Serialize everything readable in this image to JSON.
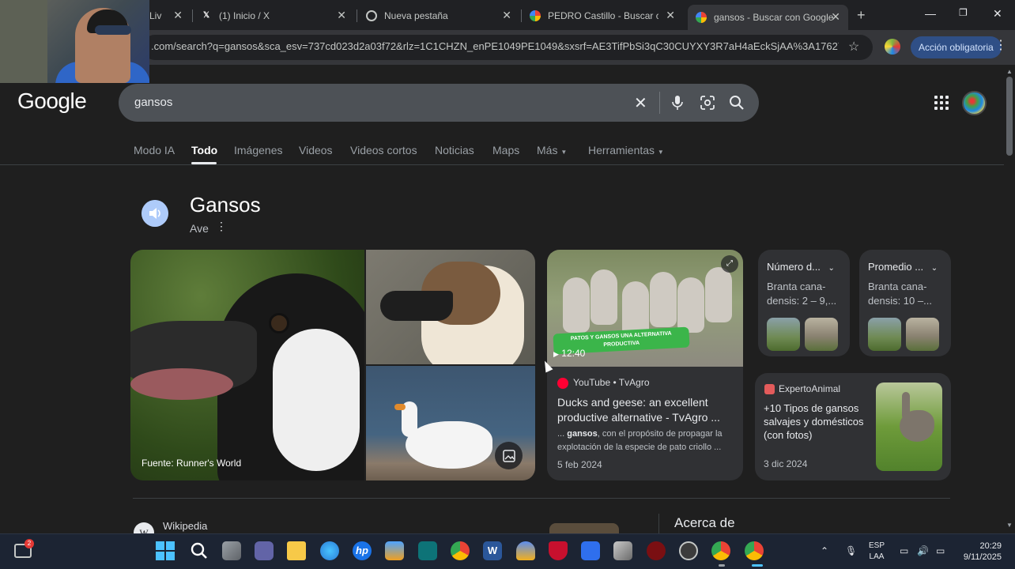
{
  "browser": {
    "tabs": [
      {
        "title": "Liv",
        "active": false
      },
      {
        "title": "(1) Inicio / X",
        "active": false
      },
      {
        "title": "Nueva pestaña",
        "active": false
      },
      {
        "title": "PEDRO Castillo - Buscar con",
        "active": false
      },
      {
        "title": "gansos - Buscar con Google",
        "active": true
      }
    ],
    "url": ".com/search?q=gansos&sca_esv=737cd023d2a03f72&rlz=1C1CHZN_enPE1049PE1049&sxsrf=AE3TifPbSi3qC30CUYXY3R7aH4aEckSjAA%3A1762738...",
    "action_button": "Acción obligatoria"
  },
  "google": {
    "logo": "Google",
    "query": "gansos",
    "nav_tabs": [
      {
        "label": "Modo IA",
        "active": false
      },
      {
        "label": "Todo",
        "active": true
      },
      {
        "label": "Imágenes",
        "active": false
      },
      {
        "label": "Videos",
        "active": false
      },
      {
        "label": "Videos cortos",
        "active": false
      },
      {
        "label": "Noticias",
        "active": false
      },
      {
        "label": "Maps",
        "active": false
      },
      {
        "label": "Más",
        "active": false
      },
      {
        "label": "Herramientas",
        "active": false
      }
    ]
  },
  "knowledge_panel": {
    "title": "Gansos",
    "subtitle": "Ave",
    "image_source": "Fuente: Runner's World"
  },
  "video_card": {
    "duration": "12:40",
    "banner": "PATOS Y GANSOS UNA ALTERNATIVA PRODUCTIVA",
    "source": "YouTube • TvAgro",
    "title": "Ducks and geese: an excellent productive alternative - TvAgro ...",
    "snippet_bold": "gansos",
    "snippet_pre": "... ",
    "snippet_post": ", con el propósito de propagar la explotación de la especie de pato criollo ...",
    "date": "5 feb 2024"
  },
  "stats": [
    {
      "title": "Número d...",
      "value": "Branta cana-densis: 2 – 9,..."
    },
    {
      "title": "Promedio ...",
      "value": "Branta cana-densis: 10 –..."
    }
  ],
  "article_card": {
    "source": "ExpertoAnimal",
    "title": "+10 Tipos de gansos salvajes y domésticos (con fotos)",
    "date": "3 dic 2024"
  },
  "results": {
    "wiki_source": "Wikipedia",
    "about_heading": "Acerca de"
  },
  "taskbar": {
    "notification_count": "2",
    "language_line1": "ESP",
    "language_line2": "LAA",
    "time": "20:29",
    "date": "9/11/2025"
  }
}
